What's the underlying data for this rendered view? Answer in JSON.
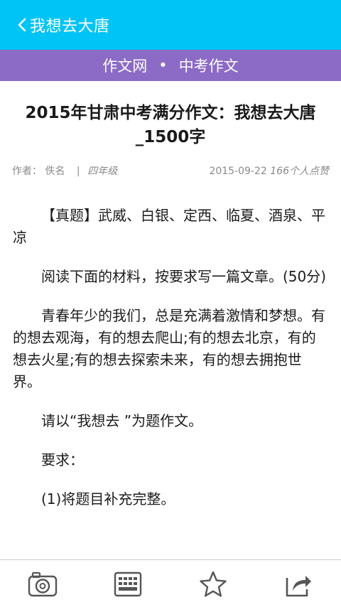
{
  "header": {
    "title": "我想去大唐",
    "back_icon": "chevron-left-icon"
  },
  "banner": {
    "site_link": "作文网",
    "separator": "•",
    "category_link": "中考作文"
  },
  "article": {
    "title": "2015年甘肃中考满分作文：我想去大唐_1500字",
    "author_label": "作者：",
    "author": "佚名",
    "grade_separator": "|",
    "grade": "四年级",
    "date": "2015-09-22",
    "likes": "166个人点赞",
    "paragraphs": [
      "【真题】武威、白银、定西、临夏、酒泉、平凉",
      "阅读下面的材料，按要求写一篇文章。(50分)",
      "青春年少的我们，总是充满着激情和梦想。有的想去观海，有的想去爬山;有的想去北京，有的想去火星;有的想去探索未来，有的想去拥抱世界。",
      "请以“我想去 ”为题作文。",
      "要求：",
      "(1)将题目补充完整。"
    ]
  },
  "toolbar": {
    "items": [
      "camera-icon",
      "keyboard-icon",
      "star-icon",
      "share-icon"
    ]
  },
  "colors": {
    "header_bg": "#00c4f6",
    "banner_bg": "#8b6bc6",
    "meta_text": "#8a8a8a"
  }
}
